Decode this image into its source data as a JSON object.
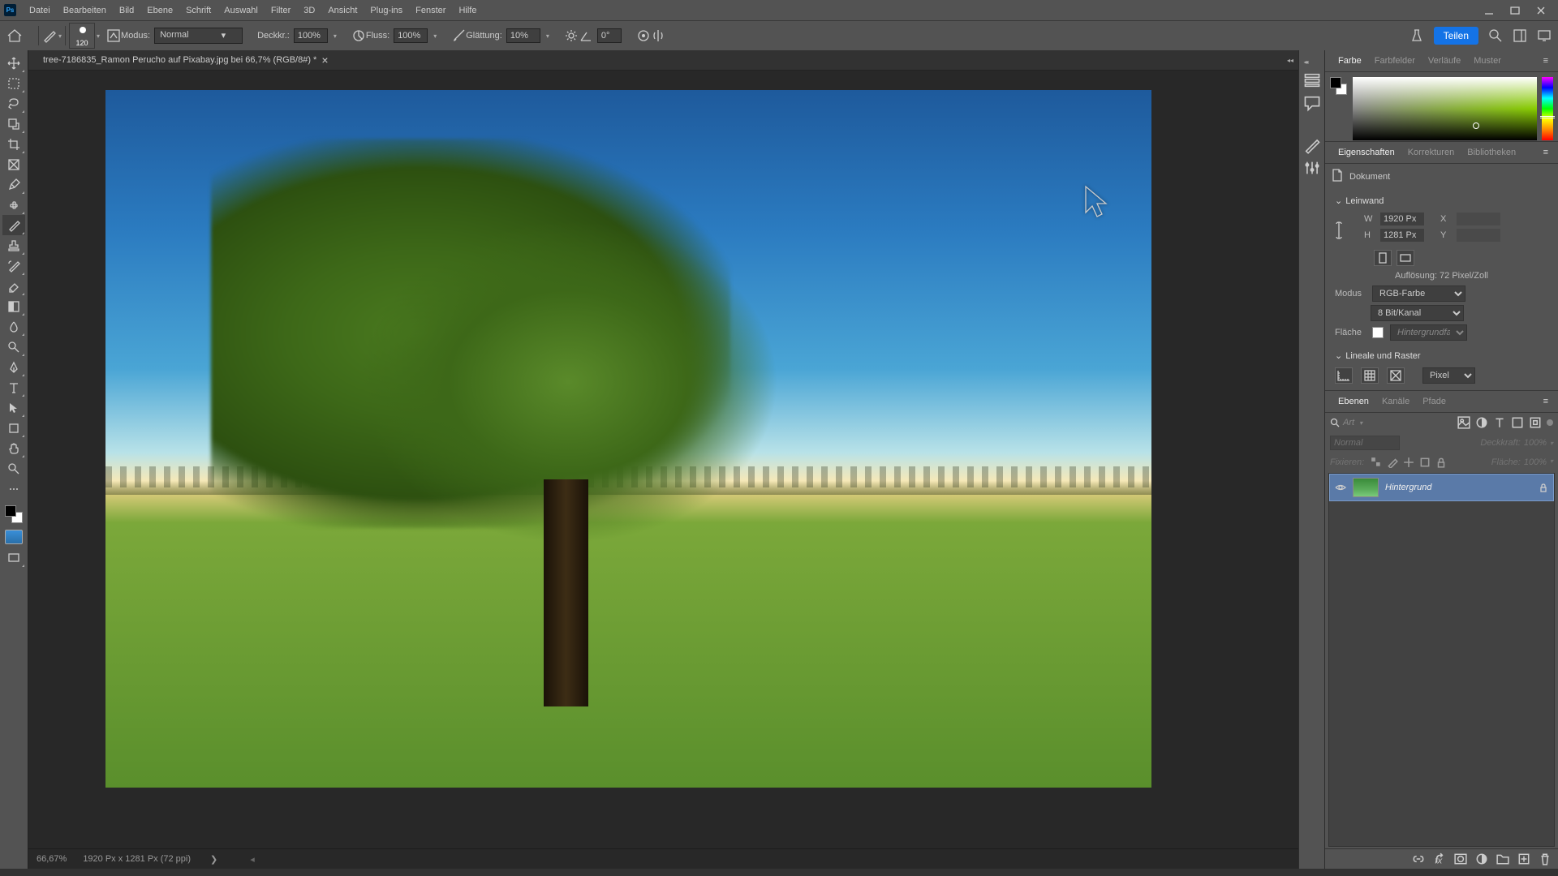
{
  "menubar": {
    "items": [
      "Datei",
      "Bearbeiten",
      "Bild",
      "Ebene",
      "Schrift",
      "Auswahl",
      "Filter",
      "3D",
      "Ansicht",
      "Plug-ins",
      "Fenster",
      "Hilfe"
    ]
  },
  "optbar": {
    "brush_size": "120",
    "modus_label": "Modus:",
    "modus_value": "Normal",
    "opacity_label": "Deckkr.:",
    "opacity_value": "100%",
    "flow_label": "Fluss:",
    "flow_value": "100%",
    "smoothing_label": "Glättung:",
    "smoothing_value": "10%",
    "angle_value": "0°",
    "share": "Teilen"
  },
  "tab": {
    "title": "tree-7186835_Ramon Perucho auf Pixabay.jpg bei 66,7% (RGB/8#) *"
  },
  "status": {
    "zoom": "66,67%",
    "dims": "1920 Px x 1281 Px (72 ppi)"
  },
  "color_panel": {
    "tabs": [
      "Farbe",
      "Farbfelder",
      "Verläufe",
      "Muster"
    ]
  },
  "props_panel": {
    "tabs": [
      "Eigenschaften",
      "Korrekturen",
      "Bibliotheken"
    ],
    "header": "Dokument",
    "section_canvas": "Leinwand",
    "w_label": "W",
    "w_value": "1920 Px",
    "h_label": "H",
    "h_value": "1281 Px",
    "x_label": "X",
    "y_label": "Y",
    "resolution": "Auflösung: 72 Pixel/Zoll",
    "mode_label": "Modus",
    "mode_value": "RGB-Farbe",
    "bit_value": "8 Bit/Kanal",
    "fill_label": "Fläche",
    "fill_value": "Hintergrundfarbe",
    "section_rulers": "Lineale und Raster",
    "unit_value": "Pixel"
  },
  "layers_panel": {
    "tabs": [
      "Ebenen",
      "Kanäle",
      "Pfade"
    ],
    "search_ph": "Art",
    "blend_value": "Normal",
    "opacity_label": "Deckkraft:",
    "opacity_value": "100%",
    "lock_label": "Fixieren:",
    "fill_label": "Fläche:",
    "fill_value": "100%",
    "layer_name": "Hintergrund"
  }
}
